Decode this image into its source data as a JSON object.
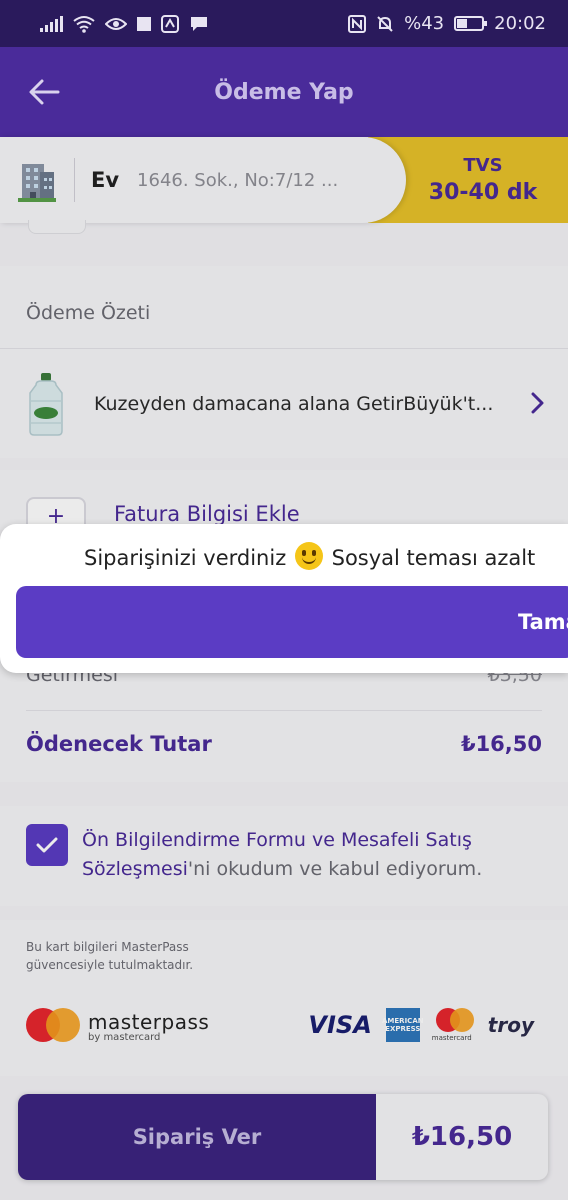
{
  "status_bar": {
    "battery": "%43",
    "time": "20:02"
  },
  "header": {
    "title": "Ödeme Yap"
  },
  "address": {
    "label": "Ev",
    "text": "1646. Sok., No:7/12 ...",
    "eta_label": "TVS",
    "eta_time": "30-40 dk"
  },
  "summary": {
    "title": "Ödeme Özeti",
    "product_name": "Kuzeyden damacana alana GetirBüyük't..."
  },
  "invoice": {
    "plus": "+",
    "label": "Fatura Bilgisi Ekle"
  },
  "totals": {
    "delivery_label": "Getirmesi",
    "delivery_value": "₺3,50",
    "total_label": "Ödenecek Tutar",
    "total_value": "₺16,50"
  },
  "agreement": {
    "link_text": "Ön Bilgilendirme Formu ve Mesafeli Satış Sözleşmesi",
    "rest_text": "'ni okudum ve kabul ediyorum."
  },
  "security": {
    "note": "Bu kart bilgileri MasterPass güvencesiyle tutulmaktadır.",
    "masterpass_word": "masterpass",
    "masterpass_sub": "by mastercard",
    "visa": "VISA",
    "amex": "AMERICAN EXPRESS",
    "mastercard": "mastercard",
    "troy": "troy"
  },
  "order": {
    "button_label": "Sipariş Ver",
    "price": "₺16,50"
  },
  "popup": {
    "message_before": "Siparişinizi verdiniz",
    "message_after": "Sosyal teması azalt",
    "button_label": "Tama"
  },
  "colors": {
    "brand_purple": "#4a2b9a",
    "accent_purple": "#5b3cc4",
    "eta_yellow": "#e8c22a"
  }
}
